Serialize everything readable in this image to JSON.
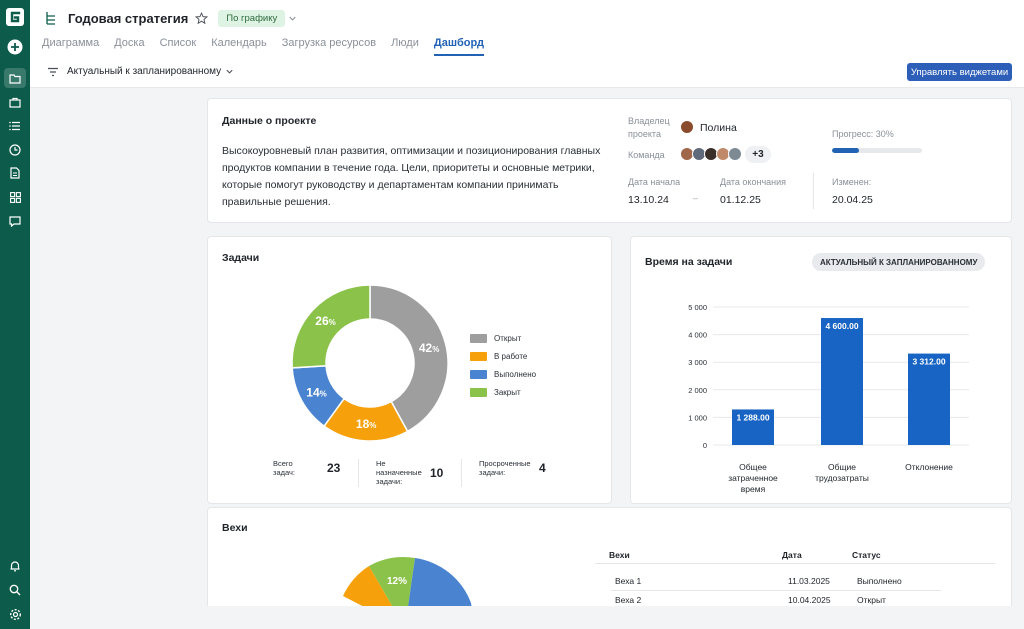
{
  "app": {
    "logo_letter": "G",
    "brand_color": "#0d5c4b",
    "accent_color": "#2162b5"
  },
  "rail": {
    "items": [
      "plus-icon",
      "folder-icon",
      "briefcase-icon",
      "list-icon",
      "clock-icon",
      "document-icon",
      "grid-icon",
      "chat-icon"
    ],
    "bottom": [
      "bell-icon",
      "search-icon",
      "gear-icon"
    ]
  },
  "header": {
    "title": "Годовая стратегия",
    "status": "По графику",
    "tabs": [
      {
        "label": "Диаграмма",
        "active": false
      },
      {
        "label": "Доска",
        "active": false
      },
      {
        "label": "Список",
        "active": false
      },
      {
        "label": "Календарь",
        "active": false
      },
      {
        "label": "Загрузка ресурсов",
        "active": false
      },
      {
        "label": "Люди",
        "active": false
      },
      {
        "label": "Дашборд",
        "active": true
      }
    ],
    "filter": "Актуальный к запланированному",
    "manage_button": "Управлять виджетами"
  },
  "project": {
    "title": "Данные о проекте",
    "description": "Высокоуровневый план развития, оптимизации и позиционирования главных продуктов компании в течение года. Цели, приоритеты и основные метрики, которые помогут руководству и департаментам компании принимать правильные решения.",
    "owner_label_1": "Владелец",
    "owner_label_2": "проекта",
    "owner_name": "Полина",
    "team_label": "Команда",
    "team_extra": "+3",
    "progress_label": "Прогресс: 30%",
    "progress_value": 0.3,
    "start_label": "Дата начала",
    "start_value": "13.10.24",
    "range_dash": "–",
    "end_label": "Дата окончания",
    "end_value": "01.12.25",
    "changed_label": "Изменен:",
    "changed_value": "20.04.25"
  },
  "tasks": {
    "title": "Задачи",
    "legend": [
      {
        "label": "Открыт",
        "color": "#9e9e9e"
      },
      {
        "label": "В работе",
        "color": "#f6a00c"
      },
      {
        "label": "Выполнено",
        "color": "#4a84d0"
      },
      {
        "label": "Закрыт",
        "color": "#8bc34a"
      }
    ],
    "total_label_1": "Всего",
    "total_label_2": "задач:",
    "total_value": "23",
    "unassigned_label_1": "Не",
    "unassigned_label_2": "назначенные",
    "unassigned_label_3": "задачи:",
    "unassigned_value": "10",
    "overdue_label_1": "Просроченные",
    "overdue_label_2": "задачи:",
    "overdue_value": "4"
  },
  "time": {
    "title": "Время на задачи",
    "chip": "АКТУАЛЬНЫЙ К ЗАПЛАНИРОВАННОМУ"
  },
  "milestones": {
    "title": "Вехи",
    "headers": {
      "name": "Вехи",
      "date": "Дата",
      "status": "Статус"
    },
    "rows": [
      {
        "name": "Веха 1",
        "date": "11.03.2025",
        "status": "Выполнено"
      },
      {
        "name": "Веха 2",
        "date": "10.04.2025",
        "status": "Открыт"
      }
    ],
    "pie_label": "12%"
  },
  "chart_data": [
    {
      "type": "pie",
      "title": "Задачи",
      "labels": [
        "Открыт",
        "В работе",
        "Выполнено",
        "Закрыт"
      ],
      "values": [
        42,
        18,
        14,
        26
      ],
      "unit": "%",
      "colors": [
        "#9e9e9e",
        "#f6a00c",
        "#4a84d0",
        "#8bc34a"
      ],
      "donut": true,
      "legend": "right"
    },
    {
      "type": "bar",
      "title": "Время на задачи",
      "categories": [
        "Общее затраченное время",
        "Общие трудозатраты",
        "Отклонение"
      ],
      "values": [
        1288,
        4600,
        3312
      ],
      "value_labels": [
        "1 288.00",
        "4 600.00",
        "3 312.00"
      ],
      "yticks": [
        "0",
        "1 000",
        "2 000",
        "3 000",
        "4 000",
        "5 000"
      ],
      "ylim": [
        0,
        5000
      ],
      "grid": true,
      "bar_color": "#1764c4"
    }
  ]
}
